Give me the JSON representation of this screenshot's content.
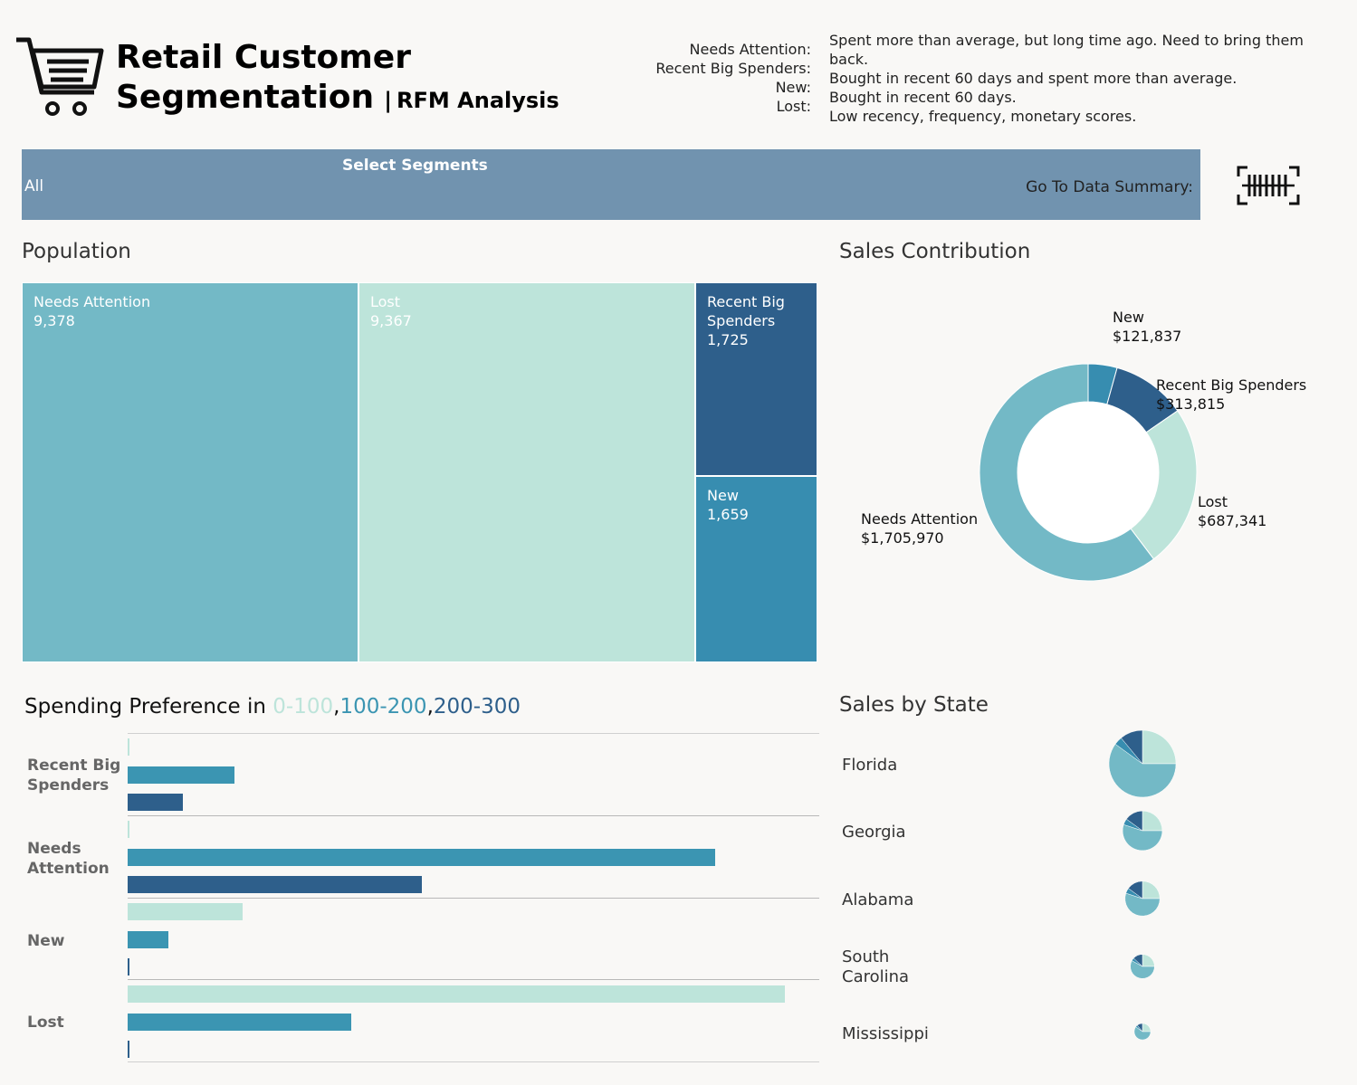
{
  "header": {
    "title_line1": "Retail Customer",
    "title_line2": "Segmentation",
    "separator": "|",
    "subtitle": "RFM Analysis",
    "icon": "shopping-cart-icon"
  },
  "definitions": [
    {
      "key": "Needs Attention:",
      "desc": "Spent more than average, but long time ago. Need to bring them back."
    },
    {
      "key": "Recent Big Spenders:",
      "desc": "Bought in recent 60 days and spent more than average."
    },
    {
      "key": "New:",
      "desc": "Bought in recent 60 days."
    },
    {
      "key": "Lost:",
      "desc": "Low recency, frequency, monetary scores."
    }
  ],
  "filter_bar": {
    "title": "Select Segments",
    "selected_value": "All",
    "go_label": "Go To Data Summary:",
    "go_icon": "barcode-scan-icon"
  },
  "colors": {
    "needs_attention": "#73b9c6",
    "lost": "#bde4da",
    "recent_big": "#2e5f8b",
    "new": "#378db0",
    "mid_teal": "#3b95b2",
    "banner": "#7193af"
  },
  "population": {
    "title": "Population",
    "tiles": [
      {
        "name": "Needs Attention",
        "value": "9,378"
      },
      {
        "name": "Lost",
        "value": "9,367"
      },
      {
        "name_line1": "Recent Big",
        "name_line2": "Spenders",
        "value": "1,725"
      },
      {
        "name": "New",
        "value": "1,659"
      }
    ]
  },
  "sales_contribution": {
    "title": "Sales Contribution",
    "labels": [
      {
        "name": "New",
        "value": "$121,837"
      },
      {
        "name": "Recent Big Spenders",
        "value": "$313,815"
      },
      {
        "name": "Lost",
        "value": "$687,341"
      },
      {
        "name": "Needs Attention",
        "value": "$1,705,970"
      }
    ]
  },
  "spending": {
    "title_prefix": "Spending Preference in ",
    "range1": "0-100",
    "comma1": ",",
    "range2": "100-200",
    "comma2": ",",
    "range3": "200-300"
  },
  "sales_by_state": {
    "title": "Sales by State",
    "states": [
      {
        "name": "Florida"
      },
      {
        "name": "Georgia"
      },
      {
        "name": "Alabama"
      },
      {
        "name_line1": "South",
        "name_line2": "Carolina"
      },
      {
        "name": "Mississippi"
      }
    ]
  },
  "chart_data": [
    {
      "type": "treemap",
      "title": "Population",
      "categories": [
        "Needs Attention",
        "Lost",
        "Recent Big Spenders",
        "New"
      ],
      "values": [
        9378,
        9367,
        1725,
        1659
      ]
    },
    {
      "type": "pie",
      "title": "Sales Contribution",
      "categories": [
        "New",
        "Recent Big Spenders",
        "Lost",
        "Needs Attention"
      ],
      "values": [
        121837,
        313815,
        687341,
        1705970
      ]
    },
    {
      "type": "bar",
      "title": "Spending Preference in 0-100,100-200,200-300",
      "categories": [
        "Recent Big Spenders",
        "Needs Attention",
        "New",
        "Lost"
      ],
      "series": [
        {
          "name": "0-100",
          "values": [
            1,
            1,
            100,
            570
          ]
        },
        {
          "name": "100-200",
          "values": [
            93,
            510,
            35,
            194
          ]
        },
        {
          "name": "200-300",
          "values": [
            48,
            255,
            1,
            1
          ]
        }
      ]
    },
    {
      "type": "pie",
      "title": "Sales by State",
      "categories": [
        "Florida",
        "Georgia",
        "Alabama",
        "South Carolina",
        "Mississippi"
      ],
      "series": [
        {
          "name": "Florida",
          "total": 1.0,
          "slices": [
            0.25,
            0.6,
            0.04,
            0.11
          ]
        },
        {
          "name": "Georgia",
          "total": 0.35,
          "slices": [
            0.25,
            0.55,
            0.05,
            0.15
          ]
        },
        {
          "name": "Alabama",
          "total": 0.27,
          "slices": [
            0.25,
            0.55,
            0.05,
            0.15
          ]
        },
        {
          "name": "South Carolina",
          "total": 0.13,
          "slices": [
            0.25,
            0.58,
            0.04,
            0.13
          ]
        },
        {
          "name": "Mississippi",
          "total": 0.06,
          "slices": [
            0.25,
            0.6,
            0.04,
            0.11
          ]
        }
      ]
    }
  ]
}
